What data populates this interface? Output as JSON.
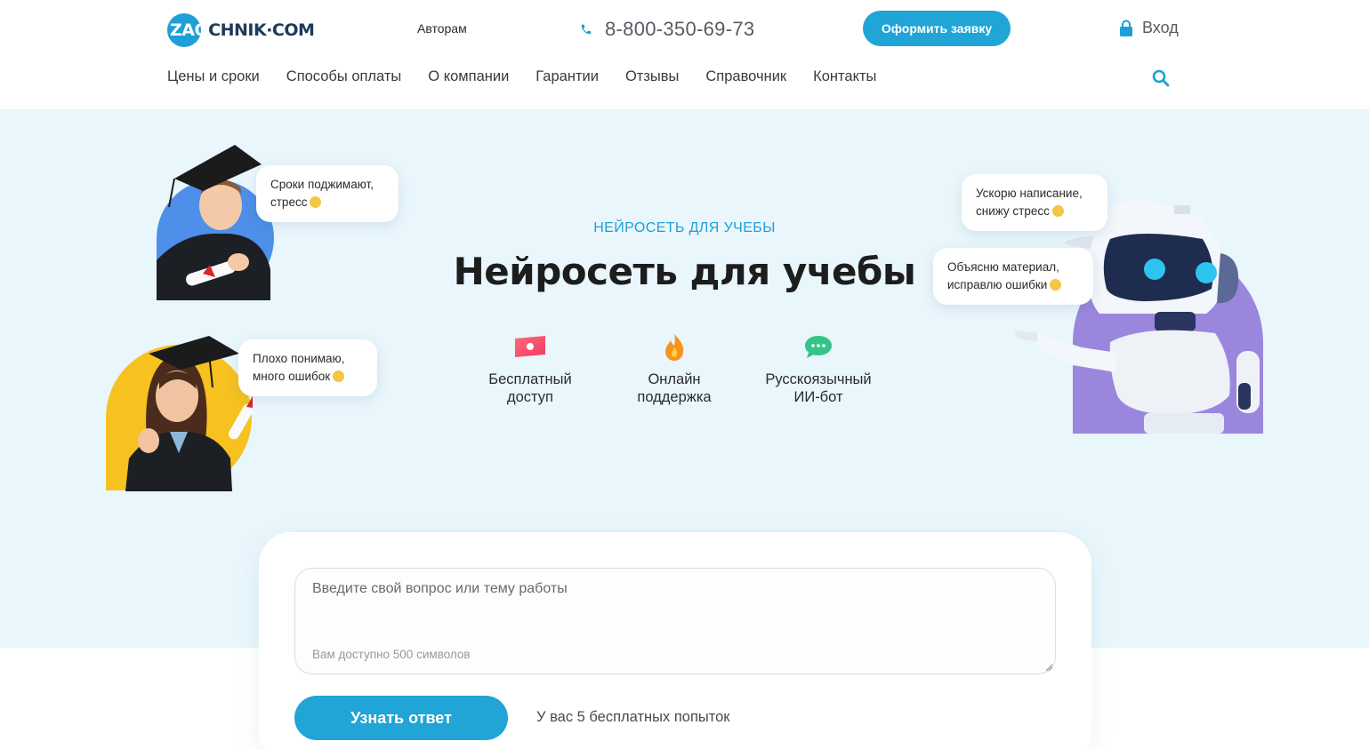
{
  "header": {
    "logo": {
      "part1": "ZAO",
      "part2": "CHNIK",
      "part3": "·COM"
    },
    "authors_link": "Авторам",
    "phone": "8-800-350-69-73",
    "order_button": "Оформить заявку",
    "login": "Вход",
    "nav": [
      "Цены и сроки",
      "Способы оплаты",
      "О компании",
      "Гарантии",
      "Отзывы",
      "Справочник",
      "Контакты"
    ],
    "icons": {
      "phone": "phone-icon",
      "login": "lock-icon",
      "search": "search-icon"
    }
  },
  "hero": {
    "subtitle": "НЕЙРОСЕТЬ ДЛЯ УЧЕБЫ",
    "title": "Нейросеть для учебы",
    "features": [
      {
        "label": "Бесплатный\nдоступ",
        "icon": "ticket-icon"
      },
      {
        "label": "Онлайн\nподдержка",
        "icon": "flame-icon"
      },
      {
        "label": "Русскоязычный\nИИ-бот",
        "icon": "chat-bubble-icon"
      }
    ],
    "bubbles": {
      "student_male": "Сроки поджимают,\nстресс",
      "student_female": "Плохо понимаю,\nмного ошибок",
      "robot_1": "Ускорю написание,\nснижу стресс",
      "robot_2": "Объясню материал,\nисправлю ошибки"
    }
  },
  "chat": {
    "question_placeholder": "Введите свой вопрос или тему работы",
    "question_value": "",
    "char_counter": "Вам доступно 500 символов",
    "submit_button": "Узнать ответ",
    "attempts_text": "У вас 5 бесплатных попыток"
  },
  "colors": {
    "accent": "#21a4d6",
    "hero_bg": "#e9f6fc",
    "title": "#1d1d1d"
  }
}
